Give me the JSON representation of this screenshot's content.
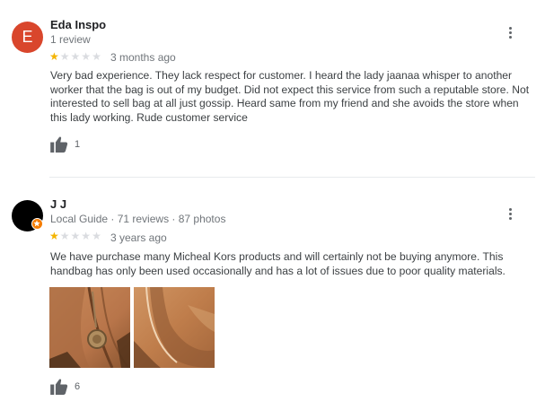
{
  "reviews": [
    {
      "avatar_letter": "E",
      "avatar_color": "#d9462c",
      "name": "Eda Inspo",
      "meta": "1 review",
      "rating": 1,
      "time": "3 months ago",
      "text": "Very bad experience. They lack respect for customer. I heard the lady jaanaa whisper to another worker that the bag is out of my budget. Did not expect this service from such a reputable store. Not interested to sell bag at all just gossip. Heard same from my friend and she avoids the store when this lady working. Rude customer service",
      "likes": "1"
    },
    {
      "avatar_color": "#000000",
      "name": "J J",
      "meta": "Local Guide · 71 reviews · 87 photos",
      "rating": 1,
      "time": "3 years ago",
      "text": "We have purchase many Micheal Kors products and will certainly not be buying anymore. This handbag has only been used occasionally and has a lot of issues due to poor quality materials.",
      "likes": "6"
    }
  ],
  "colors": {
    "star_on": "#f4b400",
    "star_off": "#dadce0",
    "local_guide_badge": "#f57c00"
  }
}
